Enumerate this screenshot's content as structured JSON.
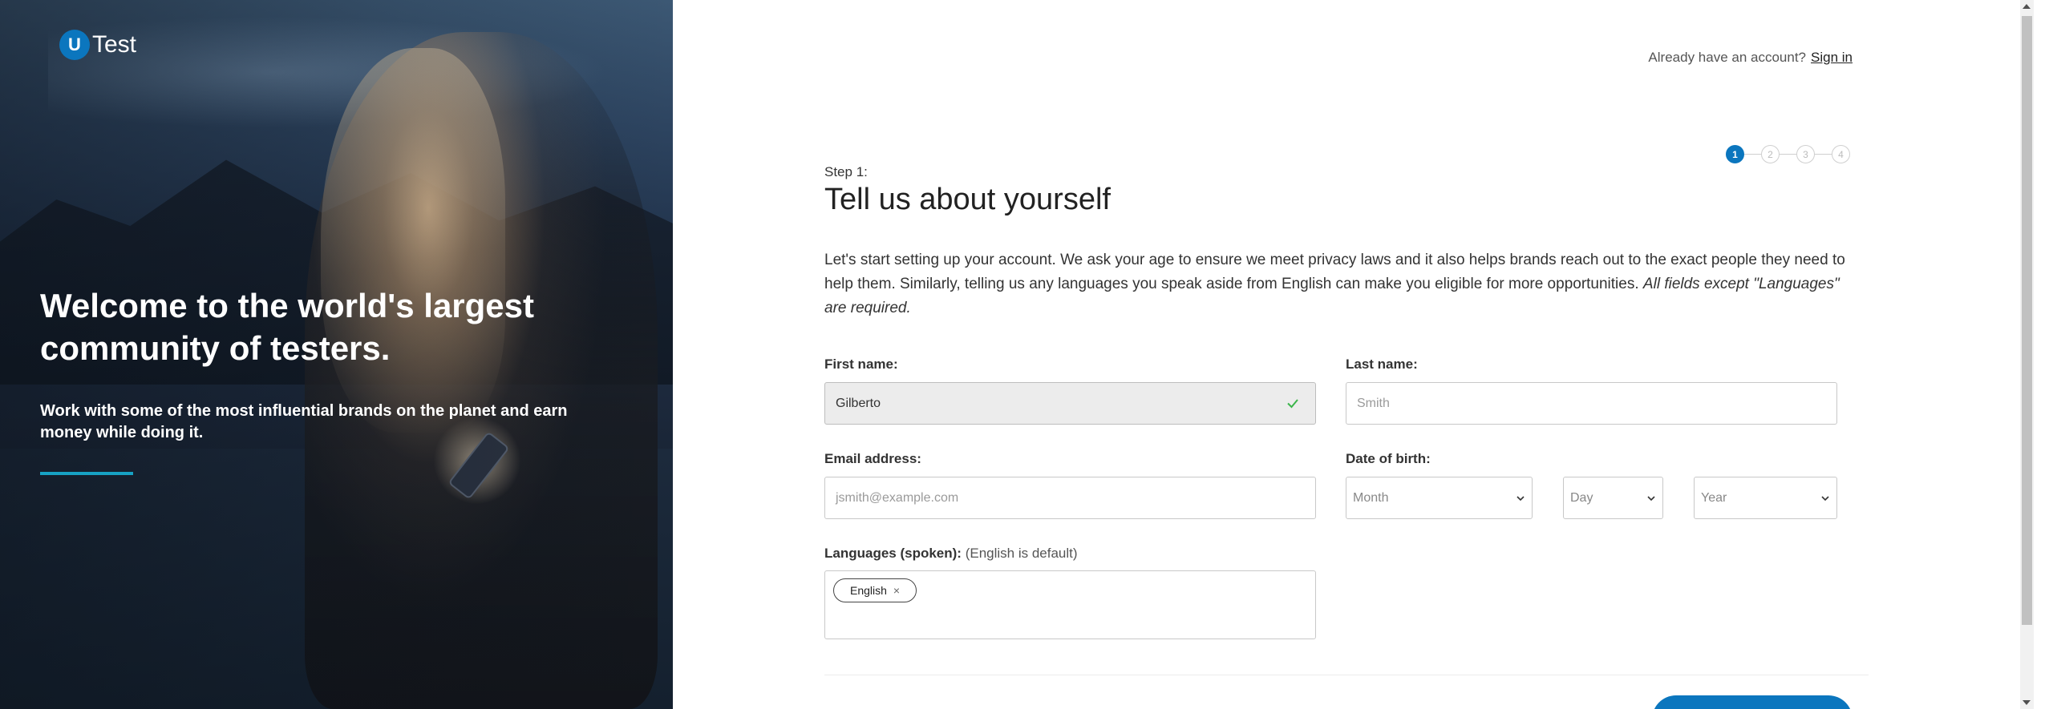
{
  "brand": {
    "logo_letter": "U",
    "logo_text": "Test",
    "accent_color": "#0b76be"
  },
  "hero": {
    "title": "Welcome to the world's largest community of testers.",
    "subtitle": "Work with some of the most influential brands on the planet and earn money while doing it."
  },
  "header": {
    "signin_prompt": "Already have an account?",
    "signin_link": "Sign in"
  },
  "stepper": {
    "steps": [
      "1",
      "2",
      "3",
      "4"
    ],
    "current": 1
  },
  "form": {
    "step_label": "Step 1:",
    "title": "Tell us about yourself",
    "intro": "Let's start setting up your account. We ask your age to ensure we meet privacy laws and it also helps brands reach out to the exact people they need to help them. Similarly, telling us any languages you speak aside from English can make you eligible for more opportunities.",
    "intro_emphasis": "All fields except \"Languages\" are required.",
    "first_name": {
      "label": "First name:",
      "value": "Gilberto"
    },
    "last_name": {
      "label": "Last name:",
      "placeholder": "Smith"
    },
    "email": {
      "label": "Email address:",
      "placeholder": "jsmith@example.com"
    },
    "dob": {
      "label": "Date of birth:",
      "month": "Month",
      "day": "Day",
      "year": "Year"
    },
    "languages": {
      "label": "Languages (spoken):",
      "hint": "(English is default)",
      "tags": [
        "English"
      ]
    }
  }
}
